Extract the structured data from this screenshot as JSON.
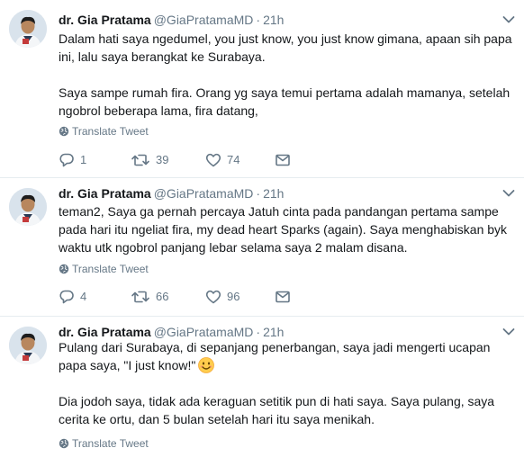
{
  "tweets": [
    {
      "name": "dr. Gia Pratama",
      "handle": "@GiaPratamaMD",
      "dot": "·",
      "time": "21h",
      "lines": [
        "Dalam hati saya ngedumel, you just know, you just know gimana, apaan sih papa",
        "ini, lalu saya berangkat ke Surabaya.",
        "",
        "Saya sampe rumah fira. Orang yg saya temui pertama adalah mamanya, setelah",
        "ngobrol beberapa lama, fira datang,"
      ],
      "translate": "Translate Tweet",
      "replies": "1",
      "retweets": "39",
      "likes": "74"
    },
    {
      "name": "dr. Gia Pratama",
      "handle": "@GiaPratamaMD",
      "dot": "·",
      "time": "21h",
      "lines": [
        "teman2, Saya ga pernah percaya Jatuh cinta pada pandangan pertama sampe",
        "pada hari itu ngeliat fira, my dead heart Sparks (again). Saya menghabiskan byk",
        "waktu utk ngobrol panjang lebar selama saya 2 malam disana."
      ],
      "translate": "Translate Tweet",
      "replies": "4",
      "retweets": "66",
      "likes": "96"
    },
    {
      "name": "dr. Gia Pratama",
      "handle": "@GiaPratamaMD",
      "dot": "·",
      "time": "21h",
      "lines": [
        "Pulang dari Surabaya, di sepanjang penerbangan, saya jadi mengerti ucapan",
        "papa saya, \"I just know!\"",
        "",
        "Dia jodoh saya, tidak ada keraguan setitik pun di hati saya. Saya pulang, saya",
        "cerita ke ortu, dan 5 bulan setelah hari itu saya menikah."
      ],
      "translate": "Translate Tweet"
    }
  ],
  "colors": {
    "text": "#14171a",
    "muted": "#657786",
    "divider": "#e6ecf0",
    "emoji": "#ffcc4d"
  },
  "icons": [
    "chevron-down-icon",
    "globe-icon",
    "reply-icon",
    "retweet-icon",
    "heart-icon",
    "envelope-icon",
    "smiling-face-emoji"
  ]
}
